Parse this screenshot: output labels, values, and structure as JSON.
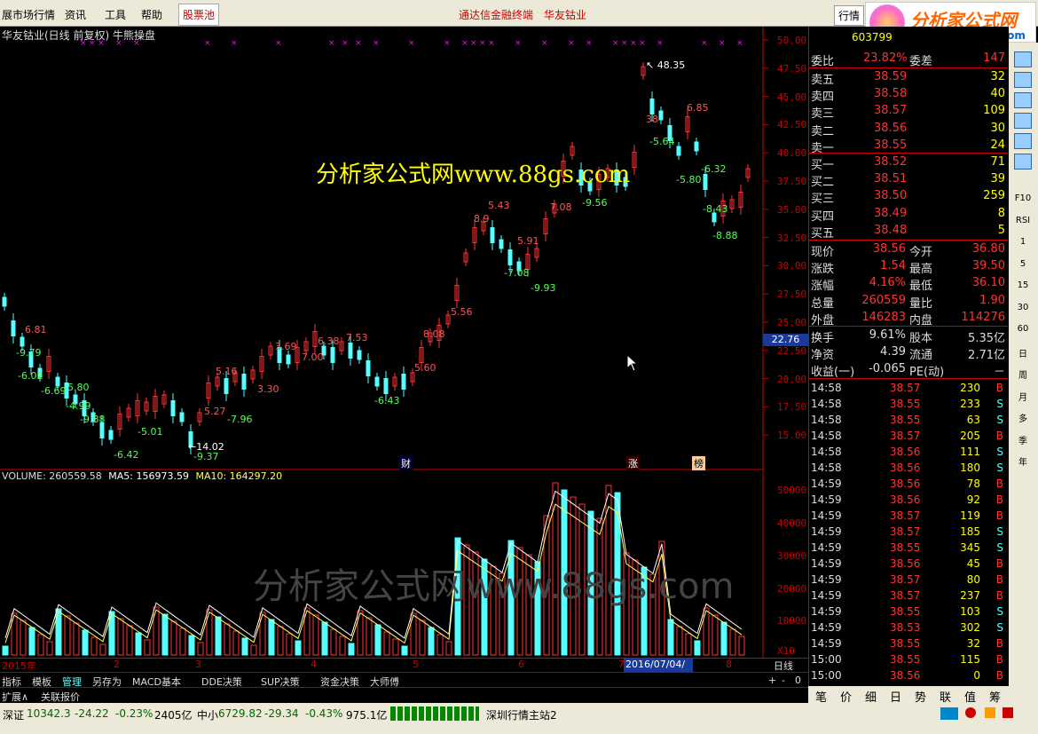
{
  "menu": {
    "m0": "展市场行情",
    "m1": "资讯",
    "m2": "工具",
    "m3": "帮助",
    "m4": "股票池",
    "center_a": "通达信金融终端",
    "center_b": "华友钴业",
    "right_tab": "行情"
  },
  "logo": {
    "text": "分析家公式网",
    "url": "www.88gs.com"
  },
  "chart": {
    "title": "华友钴业(日线 前复权) 牛熊操盘",
    "watermark_top": "分析家公式网www.88gs.com",
    "watermark_bottom": "分析家公式网www.88gs.com",
    "current_price_tag": "22.76",
    "badge_cai": "财",
    "badge_zhang": "涨",
    "badge_bang": "榜"
  },
  "price_axis": [
    "50.00",
    "47.50",
    "45.00",
    "42.50",
    "40.00",
    "37.50",
    "35.00",
    "32.50",
    "30.00",
    "27.50",
    "25.00",
    "22.50",
    "20.00",
    "17.50",
    "15.00"
  ],
  "vol_axis": [
    "50000",
    "40000",
    "30000",
    "20000",
    "10000",
    "X10"
  ],
  "annotations_red": [
    "6.81",
    "5.16",
    "5.27",
    "3.30",
    "3.69",
    "6.38",
    "7.53",
    "7.00",
    "5.60",
    "8.08",
    "5.56",
    "5.43",
    "8.9",
    "5.91",
    "7.08",
    "6.85",
    "38",
    "48.35"
  ],
  "annotations_green": [
    "-9.79",
    "-6.02",
    "-6.69",
    "-5.80",
    "-4.99",
    "-9.88",
    "-5.01",
    "-6.42",
    "-9.37",
    "-7.96",
    "-6.43",
    "-7.08",
    "-9.93",
    "-9.56",
    "-5.64",
    "-5.80",
    "-6.32",
    "-8.43",
    "-8.88"
  ],
  "annotations_white": [
    "14.02",
    "48.35"
  ],
  "volume_text": {
    "vol": "VOLUME: 260559.58",
    "ma5": "MA5: 156973.59",
    "ma10": "MA10: 164297.20"
  },
  "xaxis": {
    "y2015": "2015年",
    "m2": "2",
    "m3": "3",
    "m4": "4",
    "m5": "5",
    "m6": "6",
    "m7": "7",
    "date": "2016/07/04/—",
    "m8": "8",
    "period": "日线"
  },
  "tabs": [
    "指标",
    "模板",
    "管理",
    "另存为",
    "MACD基本",
    "DDE决策",
    "SUP决策",
    "资金决策",
    "大师傅"
  ],
  "tabs2": [
    "扩展∧",
    "关联报价"
  ],
  "pager": [
    "+",
    "-",
    "0"
  ],
  "quote": {
    "code": "603799",
    "name": "华友钴业",
    "weibi_l": "委比",
    "weibi_v": "23.82%",
    "weicha_l": "委差",
    "weicha_v": "147",
    "asks": [
      {
        "l": "卖五",
        "p": "38.59",
        "v": "32"
      },
      {
        "l": "卖四",
        "p": "38.58",
        "v": "40"
      },
      {
        "l": "卖三",
        "p": "38.57",
        "v": "109"
      },
      {
        "l": "卖二",
        "p": "38.56",
        "v": "30"
      },
      {
        "l": "卖一",
        "p": "38.55",
        "v": "24"
      }
    ],
    "bids": [
      {
        "l": "买一",
        "p": "38.52",
        "v": "71"
      },
      {
        "l": "买二",
        "p": "38.51",
        "v": "39"
      },
      {
        "l": "买三",
        "p": "38.50",
        "v": "259"
      },
      {
        "l": "买四",
        "p": "38.49",
        "v": "8"
      },
      {
        "l": "买五",
        "p": "38.48",
        "v": "5"
      }
    ],
    "stats": [
      {
        "a": "现价",
        "b": "38.56",
        "c": "今开",
        "d": "36.80"
      },
      {
        "a": "涨跌",
        "b": "1.54",
        "c": "最高",
        "d": "39.50"
      },
      {
        "a": "涨幅",
        "b": "4.16%",
        "c": "最低",
        "d": "36.10"
      },
      {
        "a": "总量",
        "b": "260559",
        "c": "量比",
        "d": "1.90"
      },
      {
        "a": "外盘",
        "b": "146283",
        "c": "内盘",
        "d": "114276"
      }
    ],
    "stats2": [
      {
        "a": "换手",
        "b": "9.61%",
        "c": "股本",
        "d": "5.35亿"
      },
      {
        "a": "净资",
        "b": "4.39",
        "c": "流通",
        "d": "2.71亿"
      },
      {
        "a": "收益(一)",
        "b": "-0.065",
        "c": "PE(动)",
        "d": "－"
      }
    ]
  },
  "ticks": [
    {
      "t": "14:58",
      "p": "38.57",
      "v": "230",
      "s": "B"
    },
    {
      "t": "14:58",
      "p": "38.55",
      "v": "233",
      "s": "S"
    },
    {
      "t": "14:58",
      "p": "38.55",
      "v": "63",
      "s": "S"
    },
    {
      "t": "14:58",
      "p": "38.57",
      "v": "205",
      "s": "B"
    },
    {
      "t": "14:58",
      "p": "38.56",
      "v": "111",
      "s": "S"
    },
    {
      "t": "14:58",
      "p": "38.56",
      "v": "180",
      "s": "S"
    },
    {
      "t": "14:59",
      "p": "38.56",
      "v": "78",
      "s": "B"
    },
    {
      "t": "14:59",
      "p": "38.56",
      "v": "92",
      "s": "B"
    },
    {
      "t": "14:59",
      "p": "38.57",
      "v": "119",
      "s": "B"
    },
    {
      "t": "14:59",
      "p": "38.57",
      "v": "185",
      "s": "S"
    },
    {
      "t": "14:59",
      "p": "38.55",
      "v": "345",
      "s": "S"
    },
    {
      "t": "14:59",
      "p": "38.56",
      "v": "45",
      "s": "B"
    },
    {
      "t": "14:59",
      "p": "38.57",
      "v": "80",
      "s": "B"
    },
    {
      "t": "14:59",
      "p": "38.57",
      "v": "237",
      "s": "B"
    },
    {
      "t": "14:59",
      "p": "38.55",
      "v": "103",
      "s": "S"
    },
    {
      "t": "14:59",
      "p": "38.53",
      "v": "302",
      "s": "S"
    },
    {
      "t": "14:59",
      "p": "38.55",
      "v": "32",
      "s": "B"
    },
    {
      "t": "15:00",
      "p": "38.55",
      "v": "115",
      "s": "B"
    },
    {
      "t": "15:00",
      "p": "38.56",
      "v": "0",
      "s": "B"
    }
  ],
  "panel_tabs": [
    "笔",
    "价",
    "细",
    "日",
    "势",
    "联",
    "值",
    "筹"
  ],
  "side": [
    "F10",
    "RSI",
    "1",
    "5",
    "15",
    "30",
    "60",
    "日",
    "周",
    "月",
    "多",
    "季",
    "年"
  ],
  "status": {
    "sz_l": "深证",
    "sz_v": "10342.3",
    "sz_c": "-24.22",
    "sz_p": "-0.23%",
    "sz_a": "2405亿",
    "zx_l": "中小",
    "zx_v": "6729.82",
    "zx_c": "-29.34",
    "zx_p": "-0.43%",
    "zx_a": "975.1亿",
    "server": "深圳行情主站2"
  },
  "colors": {
    "up": "#ff3333",
    "down": "#55ffff",
    "bg": "#000000",
    "ma5": "#ffffff",
    "ma10": "#ffff66"
  }
}
